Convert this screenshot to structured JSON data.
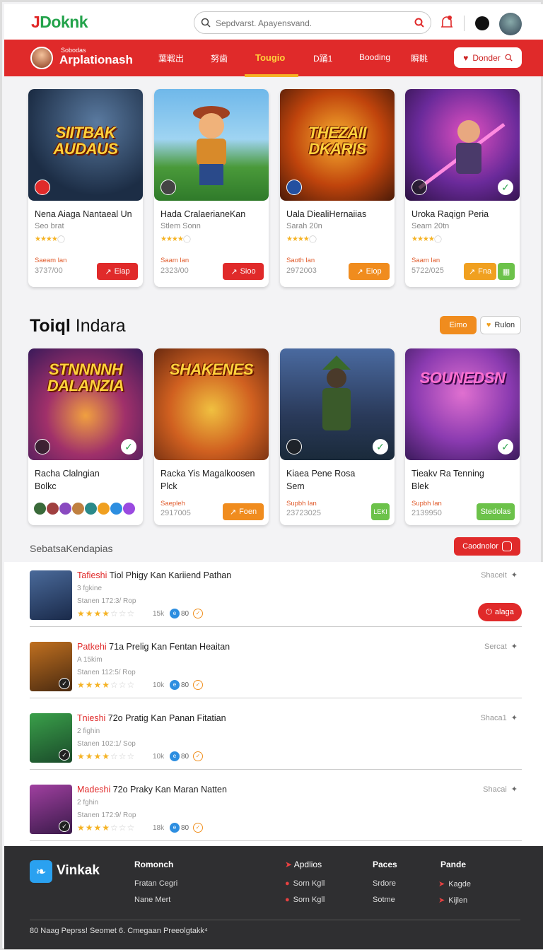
{
  "header": {
    "logo_part1": "J",
    "logo_part2": "Doknk",
    "search_placeholder": "Sepdvarst. Apayensvand.",
    "colors": {
      "brand_red": "#e02a2a",
      "logo_green": "#23a34b",
      "accent_yellow": "#ffd23c"
    }
  },
  "nav": {
    "brand_sub": "Sobodas",
    "brand_title": "Arplationash",
    "tabs": [
      {
        "label": "葉戦出"
      },
      {
        "label": "努歯"
      },
      {
        "label": "Tougio"
      },
      {
        "label": "D踊1"
      },
      {
        "label": "Booding"
      },
      {
        "label": "瞬眺"
      }
    ],
    "active_tab": "Tougio",
    "donate_label": "Donder"
  },
  "featured": [
    {
      "art_title": "SIITBAK AUDAUS",
      "name": "Nena Aiaga Nantaeal Un",
      "sub": "Seo brat",
      "price_label": "Saeam lan",
      "price": "3737/00",
      "button": "Eiap",
      "stars": 4
    },
    {
      "art_title": "",
      "name": "Hada CralaerianeKan",
      "sub": "Stlem Sonn",
      "price_label": "Saam lan",
      "price": "2323/00",
      "button": "Sioo",
      "stars": 4
    },
    {
      "art_title": "THEZAII DKARIS",
      "name": "Uala DiealiHernaiias",
      "sub": "Sarah 20n",
      "price_label": "Saoth lan",
      "price": "2972003",
      "button": "Eiop",
      "stars": 4
    },
    {
      "art_title": "",
      "name": "Uroka Raqign Peria",
      "sub": "Seam 20tn",
      "price_label": "Saam lan",
      "price": "5722/025",
      "button": "Fna",
      "stars": 4
    }
  ],
  "section": {
    "title_bold": "Toiql",
    "title_rest": " Indara",
    "btn1": "Eimo",
    "btn2": "Rulon"
  },
  "popular": [
    {
      "art_title": "STNNNNH DALANZIA",
      "name": "Racha Clalngian",
      "sub": "Bolkc",
      "price_label": "",
      "price": "",
      "button": ""
    },
    {
      "art_title": "SHAKENES",
      "name": "Racka Yis Magalkoosen",
      "sub": "Plck",
      "price_label": "Saepleh",
      "price": "2917005",
      "button": "Foen"
    },
    {
      "art_title": "",
      "name": "Kiaea Pene Rosa",
      "sub": "Sem",
      "price_label": "Supbh lan",
      "price": "23723025",
      "button": "LEKI"
    },
    {
      "art_title": "SOUNEDSN",
      "name": "Tieakv Ra Tenning",
      "sub": "Blek",
      "price_label": "Supbh lan",
      "price": "2139950",
      "button": "Stedolas"
    }
  ],
  "list_header": {
    "title": "SebatsaKendapias",
    "button": "Caodnolor"
  },
  "list": [
    {
      "hl": "Tafieshi",
      "title": " Tiol Phigy Kan Kariiend Pathan",
      "meta1": "3 fgkine",
      "meta2": "Stanen 172:3/ Rop",
      "count": "15k",
      "v": "80",
      "share": "Shaceit",
      "action": "alaga",
      "stars": 4
    },
    {
      "hl": "Patkehi",
      "title": " 71a Prelig Kan Fentan Heaitan",
      "meta1": "A 15kim",
      "meta2": "Stanen 112:5/ Rop",
      "count": "10k",
      "v": "80",
      "share": "Sercat",
      "action": "",
      "stars": 4
    },
    {
      "hl": "Tnieshi",
      "title": " 72o Pratig Kan Panan Fitatian",
      "meta1": "2 fighin",
      "meta2": "Stanen 102:1/ Sop",
      "count": "10k",
      "v": "80",
      "share": "Shaca1",
      "action": "",
      "stars": 4
    },
    {
      "hl": "Madeshi",
      "title": " 72o Praky Kan Maran Natten",
      "meta1": "2 fghin",
      "meta2": "Stanen 172:9/ Rop",
      "count": "18k",
      "v": "80",
      "share": "Shacai",
      "action": "",
      "stars": 4
    }
  ],
  "footer": {
    "brand": "Vinkak",
    "col1_head": "Romonch",
    "col1_links": [
      "Fratan Cegri",
      "Nane Mert"
    ],
    "col2_head": "Apdlios",
    "col2_links": [
      "Sorn Kgll",
      "Sorn Kgll"
    ],
    "col3_head": "Paces",
    "col3_links": [
      "Srdore",
      "Sotme"
    ],
    "col4_head": "Pande",
    "col4_links": [
      "Kagde",
      "Kijlen"
    ],
    "copyright": "80 Naag Peprss! Seomet 6. Cmegaan Preeolgtakk⁴"
  }
}
